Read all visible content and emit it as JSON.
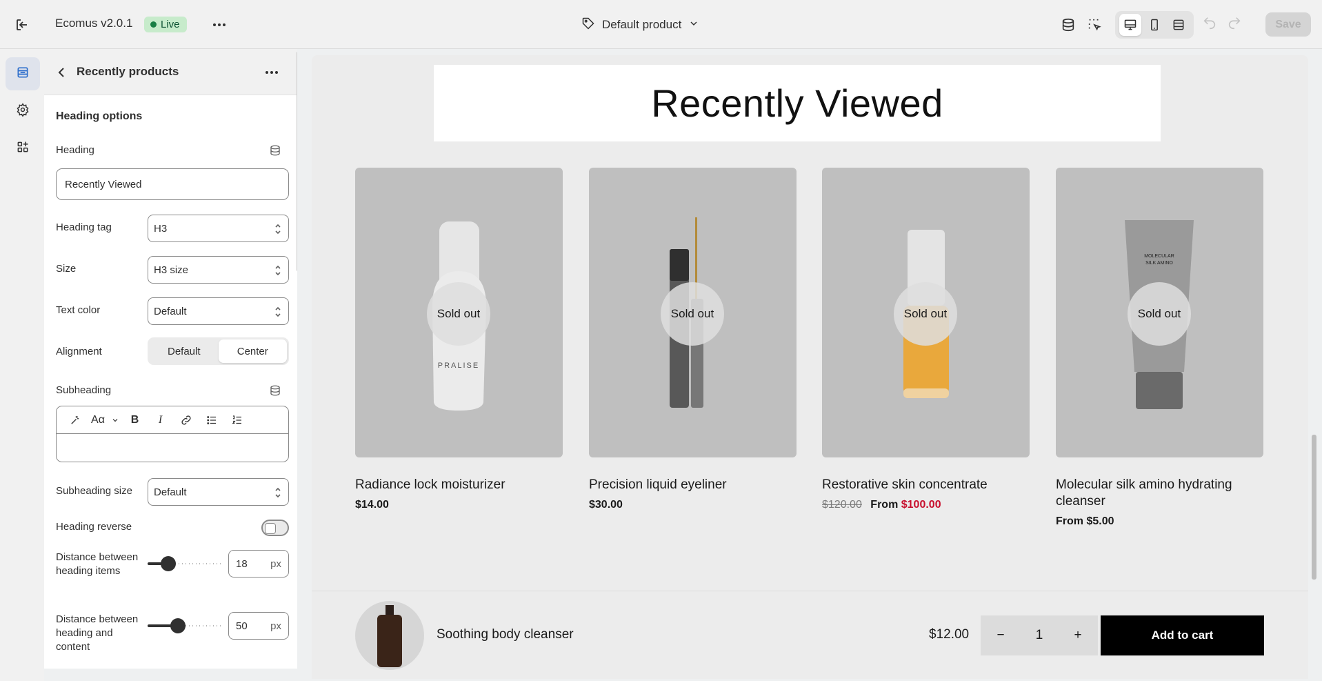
{
  "topbar": {
    "app_title": "Ecomus v2.0.1",
    "status_badge": "Live",
    "template_selector": "Default product",
    "save_label": "Save",
    "icons": [
      "exit-icon",
      "more-icon",
      "tag-icon",
      "chevron-down-icon",
      "database-icon",
      "inspector-icon",
      "desktop-icon",
      "mobile-icon",
      "fullwidth-icon",
      "undo-icon",
      "redo-icon"
    ]
  },
  "rail": {
    "items": [
      {
        "name": "sections",
        "icon": "sections-icon",
        "active": true
      },
      {
        "name": "settings",
        "icon": "gear-icon",
        "active": false
      },
      {
        "name": "apps",
        "icon": "apps-icon",
        "active": false
      }
    ]
  },
  "panel": {
    "title": "Recently products",
    "section_title": "Heading options",
    "heading": {
      "label": "Heading",
      "value": "Recently Viewed"
    },
    "heading_tag": {
      "label": "Heading tag",
      "value": "H3"
    },
    "size": {
      "label": "Size",
      "value": "H3 size"
    },
    "text_color": {
      "label": "Text color",
      "value": "Default"
    },
    "alignment": {
      "label": "Alignment",
      "options": [
        "Default",
        "Center"
      ],
      "selected": "Center"
    },
    "subheading": {
      "label": "Subheading",
      "value": ""
    },
    "subheading_size": {
      "label": "Subheading size",
      "value": "Default"
    },
    "heading_reverse": {
      "label": "Heading reverse",
      "checked": false
    },
    "distance_items": {
      "label": "Distance between heading items",
      "value": "18",
      "unit": "px",
      "slider_fraction": 0.27
    },
    "distance_content": {
      "label": "Distance between heading and content",
      "value": "50",
      "unit": "px",
      "slider_fraction": 0.39
    }
  },
  "preview": {
    "heading": "Recently Viewed",
    "products": [
      {
        "name": "Radiance lock moisturizer",
        "price": "$14.00",
        "badge": "Sold out"
      },
      {
        "name": "Precision liquid eyeliner",
        "price": "$30.00",
        "badge": "Sold out"
      },
      {
        "name": "Restorative skin concentrate",
        "old_price": "$120.00",
        "prefix": "From",
        "price": "$100.00",
        "badge": "Sold out"
      },
      {
        "name": "Molecular silk amino hydrating cleanser",
        "price": "From $5.00",
        "badge": "Sold out"
      }
    ],
    "sticky": {
      "name": "Soothing body cleanser",
      "price": "$12.00",
      "qty": "1",
      "minus": "−",
      "plus": "+",
      "add_to_cart": "Add to cart"
    }
  },
  "colors": {
    "accent": "#2c6ecb",
    "sale": "#c8102e",
    "live_bg": "#c7ebcb",
    "live_text": "#0c5132"
  }
}
